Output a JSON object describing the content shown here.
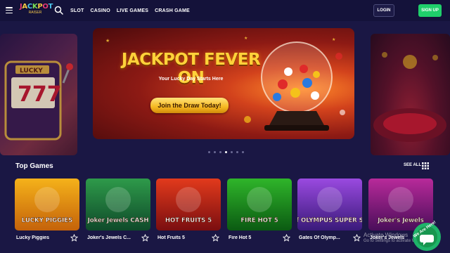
{
  "header": {
    "logo_text": "JACKPOT",
    "logo_sub": "RAISER",
    "nav": [
      "SLOT",
      "CASINO",
      "LIVE GAMES",
      "CRASH GAME"
    ],
    "login_label": "LOGIN",
    "signup_label": "SIGN UP"
  },
  "banner": {
    "title": "JACKPOT FEVER ON",
    "subtitle": "Your Lucky Day Starts Here",
    "cta_label": "Join the Draw Today!",
    "dots_count": 7,
    "active_dot": 3
  },
  "top_games": {
    "title": "Top Games",
    "see_all_label": "SEE ALL",
    "games": [
      {
        "name": "Lucky Piggies",
        "art_title": "LUCKY PIGGIES",
        "color_a": "#f5b21a",
        "color_b": "#c4620a"
      },
      {
        "name": "Joker's Jewels C...",
        "art_title": "Joker Jewels CASH",
        "color_a": "#2e9a4a",
        "color_b": "#0f4a2a"
      },
      {
        "name": "Hot Fruits 5",
        "art_title": "HOT FRUITS 5",
        "color_a": "#e23a1c",
        "color_b": "#7a0e10"
      },
      {
        "name": "Fire Hot 5",
        "art_title": "FIRE HOT 5",
        "color_a": "#2fb52a",
        "color_b": "#0b5a12"
      },
      {
        "name": "Gates Of Olymp...",
        "art_title": "Gates of OLYMPUS SUPER SCATTER",
        "color_a": "#9a4ae0",
        "color_b": "#3a1a7a"
      },
      {
        "name": "Joker's Jewels",
        "art_title": "Joker's Jewels",
        "color_a": "#b82a9a",
        "color_b": "#4a0e5a"
      }
    ]
  },
  "watermark": {
    "line1": "Activate Windows",
    "line2": "Go to Settings to activate Windows."
  },
  "chat_widget": {
    "label": "We Are Here!"
  },
  "colors": {
    "background": "#1a1744",
    "header": "#14123a",
    "signup": "#1fcf6b",
    "cta": "#f5b821"
  }
}
